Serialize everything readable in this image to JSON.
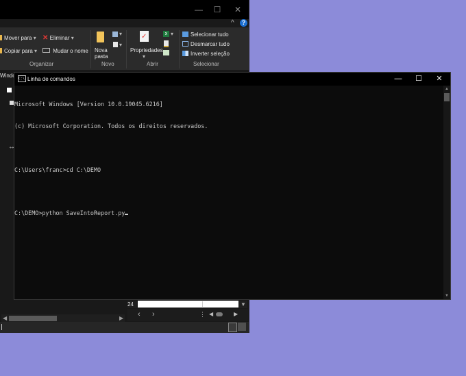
{
  "explorer": {
    "controls": {
      "minimize": "—",
      "maximize": "☐",
      "close": "✕"
    },
    "ribbon_collapse": "^",
    "help": "?",
    "organizar": {
      "move_to": "Mover para",
      "copy_to": "Copiar para",
      "delete": "Eliminar",
      "rename": "Mudar o nome",
      "label": "Organizar"
    },
    "novo": {
      "new_folder_line1": "Nova",
      "new_folder_line2": "pasta",
      "label": "Novo"
    },
    "abrir": {
      "properties": "Propriedades",
      "label": "Abrir"
    },
    "selecionar": {
      "select_all": "Selecionar tudo",
      "select_none": "Desmarcar tudo",
      "invert": "Inverter seleção",
      "label": "Selecionar"
    },
    "nav": {
      "windo_label": "Windo",
      "resize": "↔"
    },
    "preview": {
      "page_number": "24"
    }
  },
  "cmd": {
    "title": "Linha de comandos",
    "icon_text": "C:\\",
    "controls": {
      "minimize": "—",
      "maximize": "☐",
      "close": "✕"
    },
    "lines": [
      "Microsoft Windows [Version 10.0.19045.6216]",
      "(c) Microsoft Corporation. Todos os direitos reservados.",
      "",
      "C:\\Users\\franc>cd C:\\DEMO",
      "",
      "C:\\DEMO>python SaveIntoReport.py"
    ]
  },
  "colors": {
    "desktop": "#8c8bd9",
    "console_bg": "#0c0c0c",
    "console_text": "#cccccc",
    "explorer_bg": "#191919"
  }
}
